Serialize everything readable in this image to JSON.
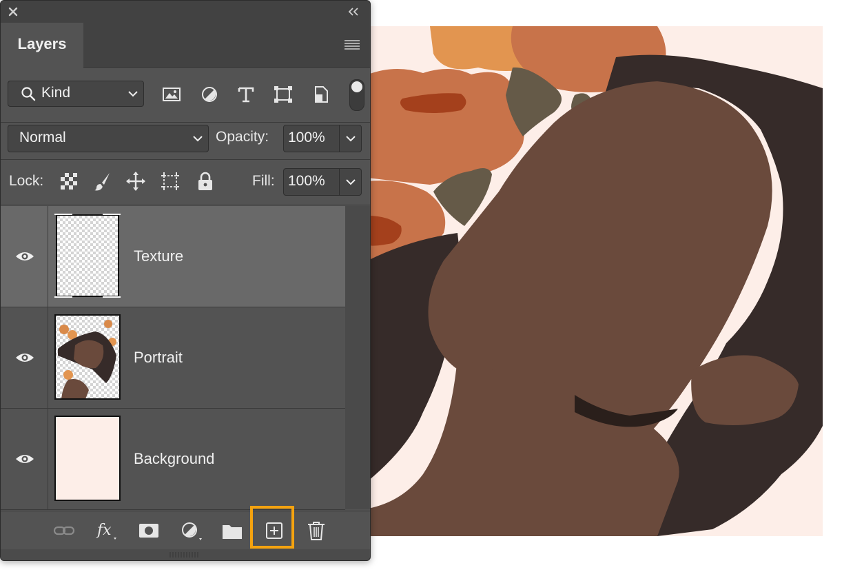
{
  "window": {
    "close_icon": "close-icon",
    "collapse_icon": "double-chevron-left-icon"
  },
  "tabs": {
    "active_label": "Layers",
    "menu_icon": "panel-menu-icon"
  },
  "filter": {
    "kind_label": "Kind",
    "icons": [
      "image-filter-icon",
      "adjustment-filter-icon",
      "type-filter-icon",
      "shape-filter-icon",
      "smart-object-filter-icon"
    ]
  },
  "blend": {
    "mode": "Normal",
    "opacity_label": "Opacity:",
    "opacity_value": "100%"
  },
  "lock": {
    "label": "Lock:",
    "icons": [
      "lock-transparent-pixels-icon",
      "lock-image-pixels-icon",
      "lock-position-icon",
      "lock-artboard-icon",
      "lock-all-icon"
    ],
    "fill_label": "Fill:",
    "fill_value": "100%"
  },
  "layers": [
    {
      "name": "Texture",
      "selected": true,
      "visible": true
    },
    {
      "name": "Portrait",
      "selected": false,
      "visible": true
    },
    {
      "name": "Background",
      "selected": false,
      "visible": true
    }
  ],
  "footer": {
    "icons": [
      "link-layers-icon",
      "layer-style-fx-icon",
      "add-mask-icon",
      "adjustment-layer-icon",
      "new-group-icon",
      "new-layer-icon",
      "delete-layer-icon"
    ],
    "highlighted": "new-layer-icon",
    "highlight_color": "#f5a30f"
  },
  "colors": {
    "panel_bg": "#535353",
    "selected_row": "#696969",
    "canvas_background": "#fdeee8",
    "skin": "#6a4a3c",
    "hair": "#362b29",
    "flower_orange": "#c8734a"
  }
}
